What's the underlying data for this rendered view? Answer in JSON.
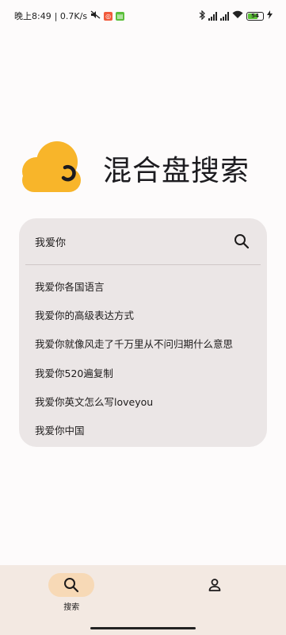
{
  "status_bar": {
    "time": "晚上8:49",
    "net_speed": "| 0.7K/s",
    "battery_level": "54",
    "icons": [
      "mute-icon",
      "app-notification-icon",
      "app-notification-icon",
      "bluetooth-icon",
      "signal-icon",
      "signal-icon",
      "wifi-icon",
      "battery-icon",
      "charging-icon"
    ]
  },
  "header": {
    "title": "混合盘搜索"
  },
  "search": {
    "query": "我爱你",
    "placeholder": "",
    "suggestions": [
      "我爱你各国语言",
      "我爱你的高级表达方式",
      "我爱你就像风走了千万里从不问归期什么意思",
      "我爱你520遍复制",
      "我爱你英文怎么写loveyou",
      "我爱你中国"
    ]
  },
  "bottom_nav": {
    "items": [
      {
        "label": "搜索",
        "icon": "search-icon",
        "active": true
      },
      {
        "label": "",
        "icon": "person-icon",
        "active": false
      }
    ]
  },
  "colors": {
    "accent": "#f7d9b6",
    "logo_yellow": "#f8b52a",
    "card_bg": "#ebe6e6",
    "nav_bg": "#f3e9e2"
  }
}
